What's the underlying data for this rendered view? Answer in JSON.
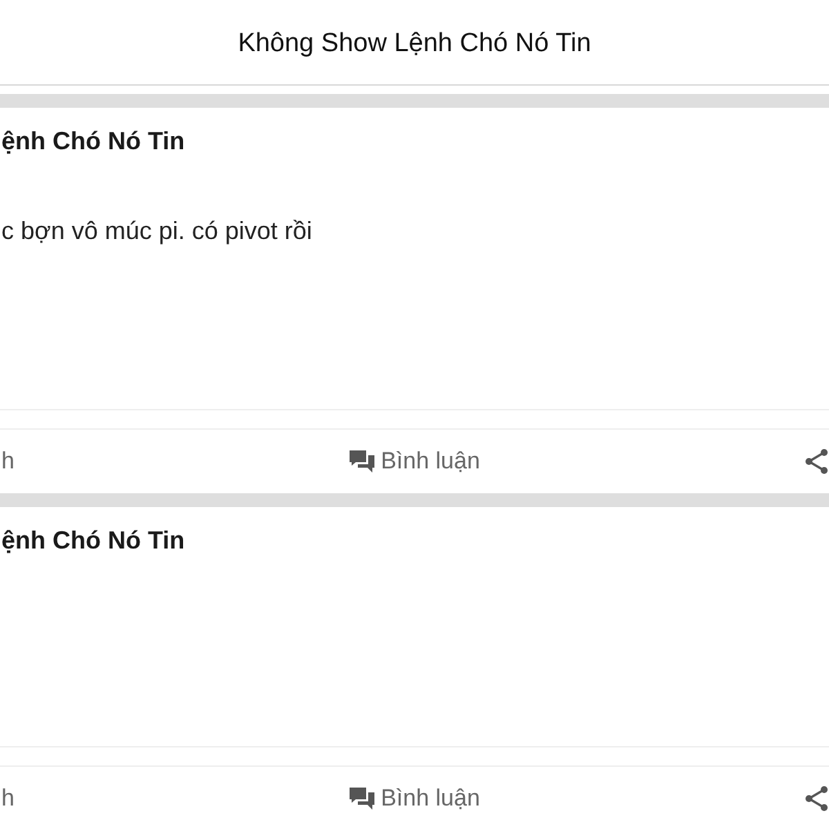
{
  "header": {
    "title": "Không Show Lệnh Chó Nó Tin"
  },
  "posts": [
    {
      "title": "ệnh Chó Nó Tin",
      "body": "c bợn vô múc pi. có pivot rồi",
      "actions": [
        {
          "kind": "like",
          "label": "h"
        },
        {
          "kind": "comment",
          "label": "Bình luận"
        },
        {
          "kind": "share"
        }
      ]
    },
    {
      "title": "ệnh Chó Nó Tin",
      "actions": [
        {
          "kind": "like",
          "label": "h"
        },
        {
          "kind": "comment",
          "label": "Bình luận"
        },
        {
          "kind": "share"
        }
      ]
    }
  ]
}
